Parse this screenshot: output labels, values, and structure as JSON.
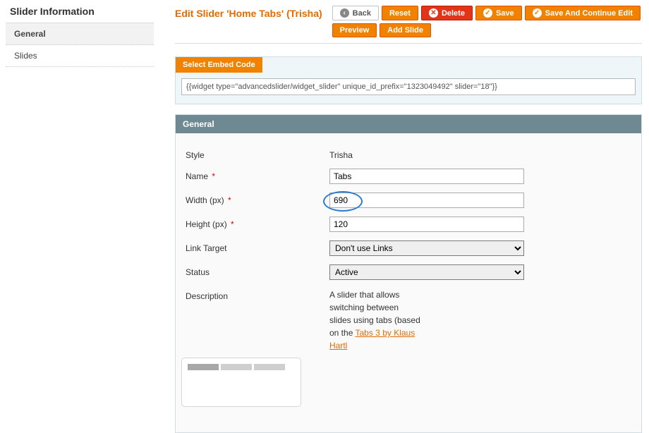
{
  "sidebar": {
    "title": "Slider Information",
    "tabs": [
      {
        "label": "General",
        "active": true
      },
      {
        "label": "Slides",
        "active": false
      }
    ]
  },
  "header": {
    "title": "Edit Slider 'Home Tabs' (Trisha)",
    "buttons": {
      "back": "Back",
      "reset": "Reset",
      "delete": "Delete",
      "save": "Save",
      "save_continue": "Save And Continue Edit",
      "preview": "Preview",
      "add_slide": "Add Slide"
    }
  },
  "embed": {
    "heading": "Select Embed Code",
    "code": "{{widget type=\"advancedslider/widget_slider\" unique_id_prefix=\"1323049492\" slider=\"18\"}}"
  },
  "panel": {
    "heading": "General",
    "fields": {
      "style": {
        "label": "Style",
        "value": "Trisha"
      },
      "name": {
        "label": "Name",
        "value": "Tabs"
      },
      "width": {
        "label": "Width (px)",
        "value": "690"
      },
      "height": {
        "label": "Height (px)",
        "value": "120"
      },
      "link_target": {
        "label": "Link Target",
        "value": "Don't use Links"
      },
      "status": {
        "label": "Status",
        "value": "Active"
      },
      "description": {
        "label": "Description",
        "text": "A slider that allows switching between slides using tabs (based on the",
        "link_text": "Tabs 3 by Klaus Hartl"
      }
    }
  }
}
